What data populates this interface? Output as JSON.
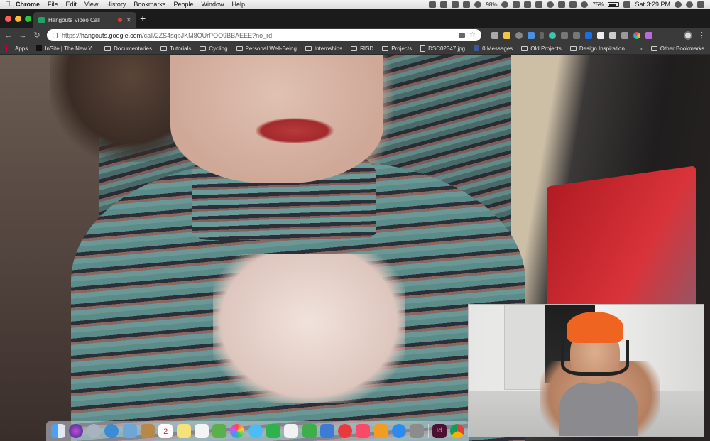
{
  "menubar": {
    "app_name": "Chrome",
    "items": [
      "File",
      "Edit",
      "View",
      "History",
      "Bookmarks",
      "People",
      "Window",
      "Help"
    ],
    "battery_percent": "75%",
    "clock": "Sat 3:29 PM",
    "wifi_battery_other": "98%"
  },
  "tab": {
    "title": "Hangouts Video Call"
  },
  "omnibox": {
    "url_scheme": "https://",
    "url_host": "hangouts.google.com",
    "url_path": "/call/2ZS4sqbJKM8OUrPOO9BBAEEE?no_rd"
  },
  "bookmarks": {
    "items": [
      {
        "label": "Apps",
        "icon": "apps-grid-icon"
      },
      {
        "label": "InSite | The New Y...",
        "icon": "nyt-icon"
      },
      {
        "label": "Documentaries",
        "icon": "folder-icon"
      },
      {
        "label": "Tutorials",
        "icon": "folder-icon"
      },
      {
        "label": "Cycling",
        "icon": "folder-icon"
      },
      {
        "label": "Personal Well-Being",
        "icon": "folder-icon"
      },
      {
        "label": "Internships",
        "icon": "folder-icon"
      },
      {
        "label": "RISD",
        "icon": "folder-icon"
      },
      {
        "label": "Projects",
        "icon": "folder-icon"
      },
      {
        "label": "DSC02347.jpg",
        "icon": "page-icon"
      },
      {
        "label": "0 Messages",
        "icon": "facebook-icon"
      },
      {
        "label": "Old Projects",
        "icon": "folder-icon"
      },
      {
        "label": "Design Inspiration",
        "icon": "folder-icon"
      }
    ],
    "more": "»",
    "other": "Other Bookmarks"
  },
  "dock": {
    "icons": [
      "finder-icon",
      "siri-icon",
      "launchpad-icon",
      "safari-icon",
      "preview-icon",
      "notes-book-icon",
      "calendar-icon",
      "stickies-icon",
      "reminders-icon",
      "photo-booth-icon",
      "photos-icon",
      "messages-icon",
      "facetime-icon",
      "textedit-icon",
      "numbers-icon",
      "keynote-icon",
      "news-icon",
      "music-icon",
      "books-icon",
      "app-store-icon",
      "system-preferences-icon",
      "indesign-icon",
      "chrome-icon"
    ],
    "calendar_day": "2",
    "indesign_label": "Id"
  },
  "colors": {
    "menubar_bg": "#e6e6e6",
    "chrome_dark": "#3a3a3a",
    "beanie_orange": "#f06421",
    "hangouts_green": "#1fa463"
  }
}
